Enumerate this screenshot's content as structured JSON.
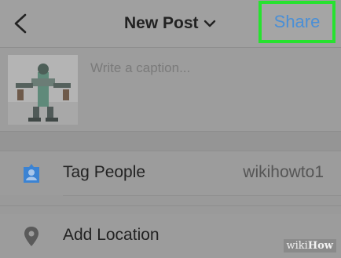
{
  "header": {
    "title": "New Post",
    "share_label": "Share"
  },
  "compose": {
    "caption_placeholder": "Write a caption..."
  },
  "rows": [
    {
      "label": "Tag People",
      "value": "wikihowto1",
      "icon": "tag-person-icon"
    },
    {
      "label": "Add Location",
      "icon": "location-pin-icon"
    }
  ],
  "watermark": {
    "brand_light": "wiki",
    "brand_bold": "How"
  },
  "colors": {
    "highlight": "#27e22f",
    "link": "#4a8fd6",
    "tag_icon": "#3b83d3"
  }
}
